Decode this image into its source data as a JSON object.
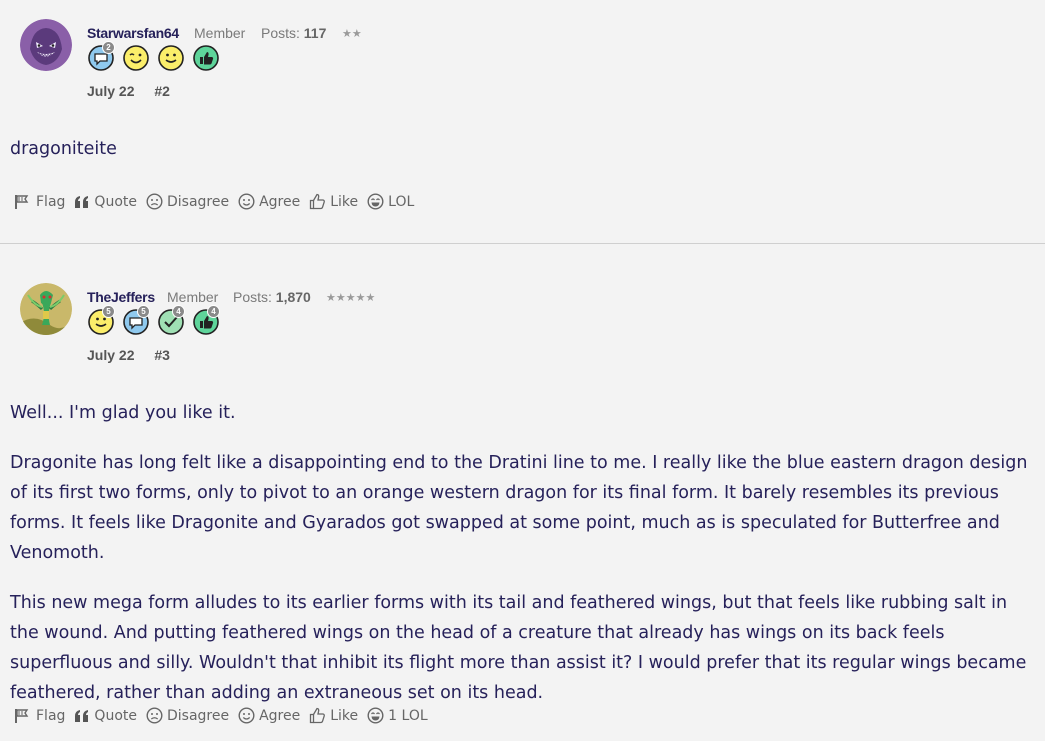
{
  "posts": [
    {
      "username": "Starwarsfan64",
      "role": "Member",
      "posts_label": "Posts:",
      "posts_count": "117",
      "stars": "★★",
      "badges": [
        {
          "icon": "comment-icon",
          "count": "2"
        },
        {
          "icon": "wink-face-icon",
          "count": ""
        },
        {
          "icon": "smile-face-icon",
          "count": ""
        },
        {
          "icon": "thumbs-up-icon",
          "count": ""
        }
      ],
      "date": "July 22",
      "number": "#2",
      "body": [
        "dragoniteite"
      ],
      "reactions": {
        "flag": "Flag",
        "quote": "Quote",
        "disagree": "Disagree",
        "agree": "Agree",
        "like": "Like",
        "lol": "LOL"
      }
    },
    {
      "username": "TheJeffers",
      "role": "Member",
      "posts_label": "Posts:",
      "posts_count": "1,870",
      "stars": "★★★★★",
      "badges": [
        {
          "icon": "smile-face-icon",
          "count": "5"
        },
        {
          "icon": "comment-icon",
          "count": "5"
        },
        {
          "icon": "checkmark-icon",
          "count": "4"
        },
        {
          "icon": "thumbs-up-icon",
          "count": "4"
        }
      ],
      "date": "July 22",
      "number": "#3",
      "body": [
        "Well... I'm glad you like it.",
        "Dragonite has long felt like a disappointing end to the Dratini line to me. I really like the blue eastern dragon design of its first two forms, only to pivot to an orange western dragon for its final form. It barely resembles its previous forms. It feels like Dragonite and Gyarados got swapped at some point, much as is speculated for Butterfree and Venomoth.",
        "This new mega form alludes to its earlier forms with its tail and feathered wings, but that feels like rubbing salt in the wound. And putting feathered wings on the head of a creature that already has wings on its back feels superfluous and silly. Wouldn't that inhibit its flight more than assist it? I would prefer that its regular wings became feathered, rather than adding an extraneous set on its head."
      ],
      "reactions": {
        "flag": "Flag",
        "quote": "Quote",
        "disagree": "Disagree",
        "agree": "Agree",
        "like": "Like",
        "lol": "1 LOL"
      }
    }
  ],
  "colors": {
    "background": "#f3f3f3",
    "text": "#26215a",
    "muted": "#666666",
    "badge_blue": "#8fc9ee",
    "badge_yellow": "#fbee6a",
    "badge_green": "#5ed49a"
  }
}
